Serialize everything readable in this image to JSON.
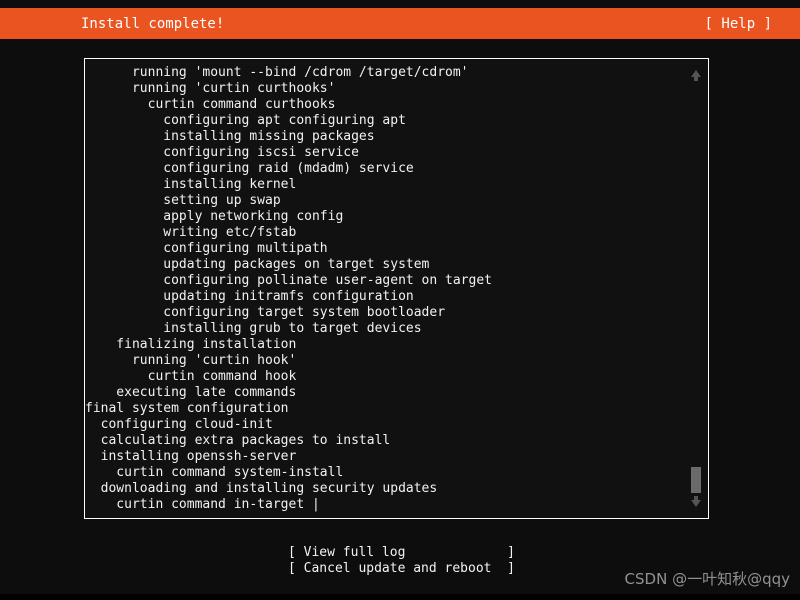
{
  "header": {
    "title": "Install complete!",
    "help_label": "[ Help ]",
    "bar_color": "#e95420",
    "text_color": "#ffffff"
  },
  "log": {
    "lines": [
      "      running 'mount --bind /cdrom /target/cdrom'",
      "      running 'curtin curthooks'",
      "        curtin command curthooks",
      "          configuring apt configuring apt",
      "          installing missing packages",
      "          configuring iscsi service",
      "          configuring raid (mdadm) service",
      "          installing kernel",
      "          setting up swap",
      "          apply networking config",
      "          writing etc/fstab",
      "          configuring multipath",
      "          updating packages on target system",
      "          configuring pollinate user-agent on target",
      "          updating initramfs configuration",
      "          configuring target system bootloader",
      "          installing grub to target devices",
      "    finalizing installation",
      "      running 'curtin hook'",
      "        curtin command hook",
      "    executing late commands",
      "final system configuration",
      "  configuring cloud-init",
      "  calculating extra packages to install",
      "  installing openssh-server",
      "    curtin command system-install",
      "  downloading and installing security updates",
      "    curtin command in-target |"
    ],
    "text_color": "#f2f2f2",
    "background_color": "#111111",
    "border_color": "#ffffff"
  },
  "scrollbar": {
    "up_arrow": "▲",
    "down_arrow": "▼",
    "thumb_color": "#6b6b6b",
    "arrow_color": "#555555"
  },
  "footer": {
    "buttons": [
      "[ View full log             ]",
      "[ Cancel update and reboot  ]"
    ]
  },
  "watermark": {
    "text": "CSDN @一叶知秋@qqy"
  }
}
